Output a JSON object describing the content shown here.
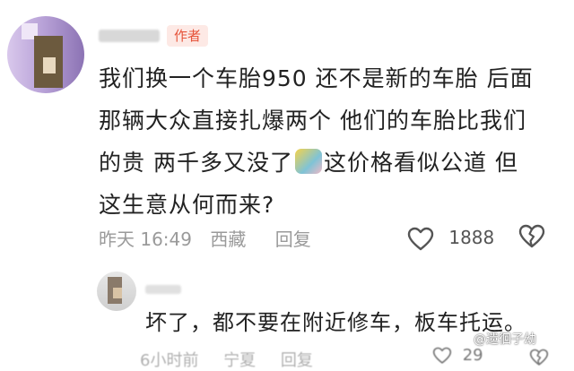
{
  "comment": {
    "author_badge": "作者",
    "text_lines": [
      "我们换一个车胎950 还不是新的车胎 后面",
      "那辆大众直接扎爆两个 他们的车胎比我们",
      "的贵 两千多又没了",
      "这价格看似公道 但",
      "这生意从何而来?"
    ],
    "time": "昨天 16:49",
    "location": "西藏",
    "reply_label": "回复",
    "like_count": "1888",
    "icons": {
      "like": "heart-icon",
      "dislike": "broken-heart-icon"
    }
  },
  "reply": {
    "text": "坏了，都不要在附近修车，板车托运。",
    "time": "6小时前",
    "location": "宁夏",
    "reply_label": "回复",
    "like_count": "29"
  },
  "watermark": {
    "text": "@遗徊子幼"
  },
  "colors": {
    "badge_text": "#e6533a",
    "badge_bg": "#fde9e5",
    "meta": "#9a9a9a",
    "text": "#222222"
  }
}
